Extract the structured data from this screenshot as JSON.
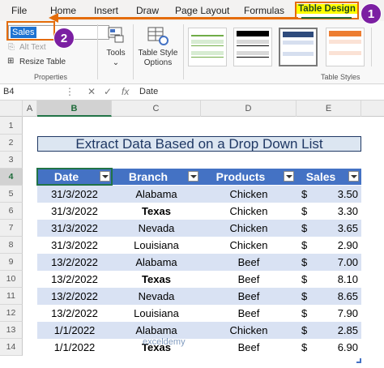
{
  "ribbon_tabs": {
    "file": "File",
    "home": "Home",
    "insert": "Insert",
    "draw": "Draw",
    "page_layout": "Page Layout",
    "formulas": "Formulas",
    "table_design": "Table Design"
  },
  "properties_group": {
    "table_name_value": "Sales",
    "alt_text": "Alt Text",
    "resize_table": "Resize Table",
    "group_label": "Properties"
  },
  "tools_button": "Tools",
  "table_style_options": [
    "Table Style",
    "Options"
  ],
  "table_styles_label": "Table Styles",
  "table_style_thumbnails": [
    {
      "name": "green-light",
      "head": "#ffffff",
      "band": "#d7ecd2",
      "line": "#70ad47"
    },
    {
      "name": "black-medium",
      "head": "#000000",
      "band": "#d9d9d9",
      "line": "#000000"
    },
    {
      "name": "blue-medium",
      "head": "#2f4b7c",
      "band": "#d6dfef",
      "line": "#4472c4",
      "selected": true
    },
    {
      "name": "orange-medium",
      "head": "#ed7d31",
      "band": "#fbe2d5",
      "line": "#ed7d31"
    }
  ],
  "annotations": {
    "badge1": "1",
    "badge2": "2",
    "color": "#e46c0a",
    "badge_color": "#7b1fa2"
  },
  "formula_bar": {
    "name_box": "B4",
    "cancel_icon": "✕",
    "enter_icon": "✓",
    "fx": "fx",
    "content": "Date"
  },
  "columns": [
    "A",
    "B",
    "C",
    "D",
    "E"
  ],
  "rows": [
    "1",
    "2",
    "3",
    "4",
    "5",
    "6",
    "7",
    "8",
    "9",
    "10",
    "11",
    "12",
    "13",
    "14"
  ],
  "sheet": {
    "title": "Extract Data Based on a Drop Down List",
    "headers": [
      "Date",
      "Branch",
      "Products",
      "Sales"
    ],
    "currency": "$",
    "rows": [
      {
        "date": "31/3/2022",
        "branch": "Alabama",
        "product": "Chicken",
        "sales": "3.50"
      },
      {
        "date": "31/3/2022",
        "branch": "Texas",
        "product": "Chicken",
        "sales": "3.30"
      },
      {
        "date": "31/3/2022",
        "branch": "Nevada",
        "product": "Chicken",
        "sales": "3.65"
      },
      {
        "date": "31/3/2022",
        "branch": "Louisiana",
        "product": "Chicken",
        "sales": "2.90"
      },
      {
        "date": "13/2/2022",
        "branch": "Alabama",
        "product": "Beef",
        "sales": "7.00"
      },
      {
        "date": "13/2/2022",
        "branch": "Texas",
        "product": "Beef",
        "sales": "8.10"
      },
      {
        "date": "13/2/2022",
        "branch": "Nevada",
        "product": "Beef",
        "sales": "8.65"
      },
      {
        "date": "13/2/2022",
        "branch": "Louisiana",
        "product": "Beef",
        "sales": "7.90"
      },
      {
        "date": "1/1/2022",
        "branch": "Alabama",
        "product": "Chicken",
        "sales": "2.85"
      },
      {
        "date": "1/1/2022",
        "branch": "Texas",
        "product": "Beef",
        "sales": "6.90"
      }
    ]
  },
  "watermark": "exceldemy",
  "colors": {
    "header": "#4472c4",
    "band": "#d9e2f3",
    "title_text": "#1f3864",
    "excel_green": "#217346"
  }
}
